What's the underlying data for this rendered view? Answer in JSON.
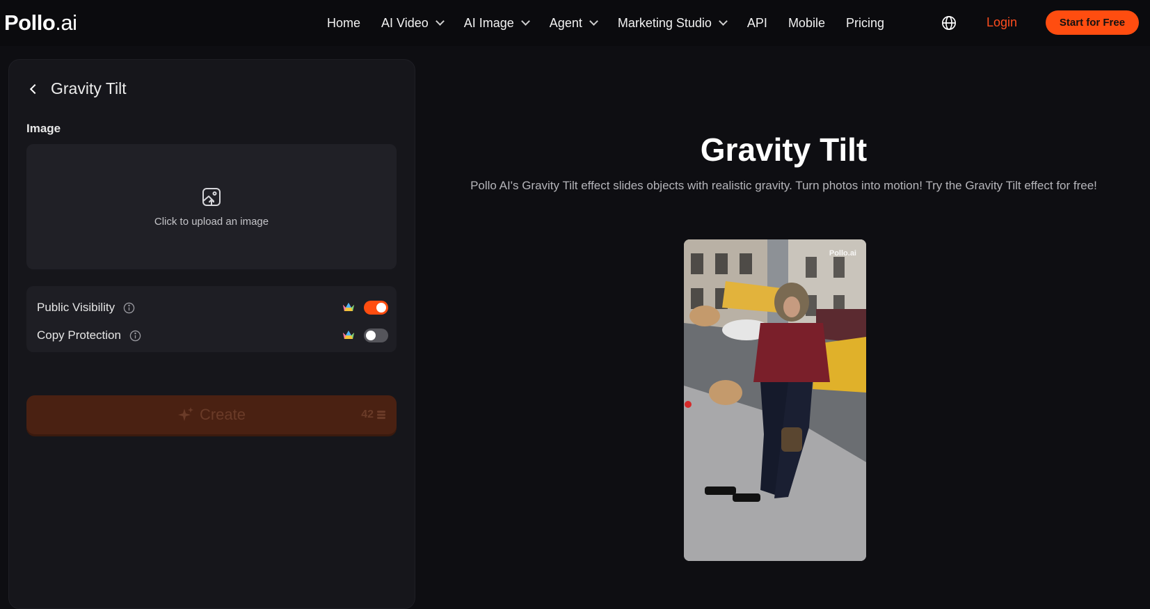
{
  "header": {
    "logo_main": "Pollo",
    "logo_suffix": ".ai",
    "nav": [
      {
        "label": "Home",
        "dropdown": false
      },
      {
        "label": "AI Video",
        "dropdown": true
      },
      {
        "label": "AI Image",
        "dropdown": true
      },
      {
        "label": "Agent",
        "dropdown": true
      },
      {
        "label": "Marketing Studio",
        "dropdown": true
      },
      {
        "label": "API",
        "dropdown": false
      },
      {
        "label": "Mobile",
        "dropdown": false
      },
      {
        "label": "Pricing",
        "dropdown": false
      }
    ],
    "language_icon": "globe-icon",
    "login_label": "Login",
    "start_label": "Start for Free"
  },
  "panel": {
    "title": "Gravity Tilt",
    "image_label": "Image",
    "upload_text": "Click to upload an image",
    "options": {
      "public_visibility": {
        "label": "Public Visibility",
        "enabled": true
      },
      "copy_protection": {
        "label": "Copy Protection",
        "enabled": false
      }
    },
    "create_label": "Create",
    "credits": "42"
  },
  "main": {
    "title": "Gravity Tilt",
    "description": "Pollo AI's Gravity Tilt effect slides objects with realistic gravity. Turn photos into motion! Try the Gravity Tilt effect for free!",
    "preview_watermark": "Pollo.ai"
  },
  "colors": {
    "accent": "#ff4d10",
    "login": "#ff4d1f",
    "background": "#0e0e12",
    "panel": "#16161b"
  }
}
